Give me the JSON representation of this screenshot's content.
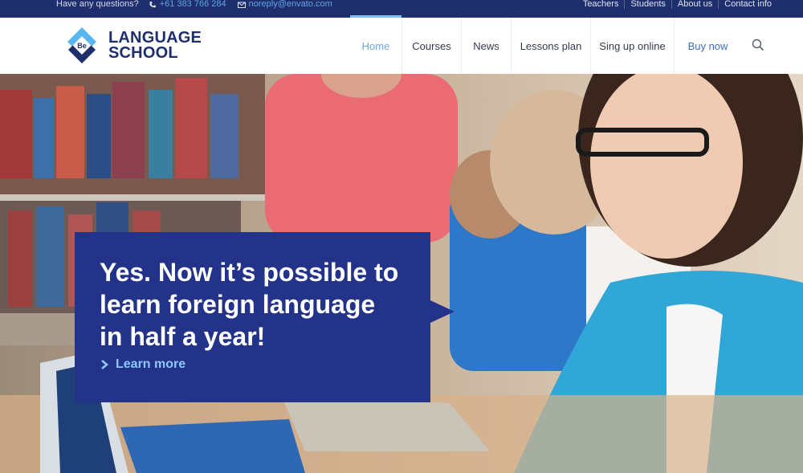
{
  "topbar": {
    "question": "Have any questions?",
    "phone": "+61 383 766 284",
    "email": "noreply@envato.com",
    "links": [
      "Teachers",
      "Students",
      "About us",
      "Contact info"
    ]
  },
  "logo": {
    "badge": "Be",
    "line1": "LANGUAGE",
    "line2": "SCHOOL"
  },
  "nav": {
    "items": [
      "Home",
      "Courses",
      "News",
      "Lessons plan",
      "Sing up online",
      "Buy now"
    ],
    "active": "Home"
  },
  "hero": {
    "headline_line1": "Yes. Now it’s possible to",
    "headline_line2": "learn foreign language",
    "headline_line3": "in half a year!",
    "cta": "Learn more"
  },
  "colors": {
    "brand": "#1f2f6e",
    "banner": "#23338a",
    "accent": "#5ea6e6",
    "cta": "#8ec6ff"
  },
  "icons": [
    "phone-icon",
    "mail-icon",
    "search-icon",
    "chevron-right-icon",
    "logo-diamond-icon"
  ]
}
